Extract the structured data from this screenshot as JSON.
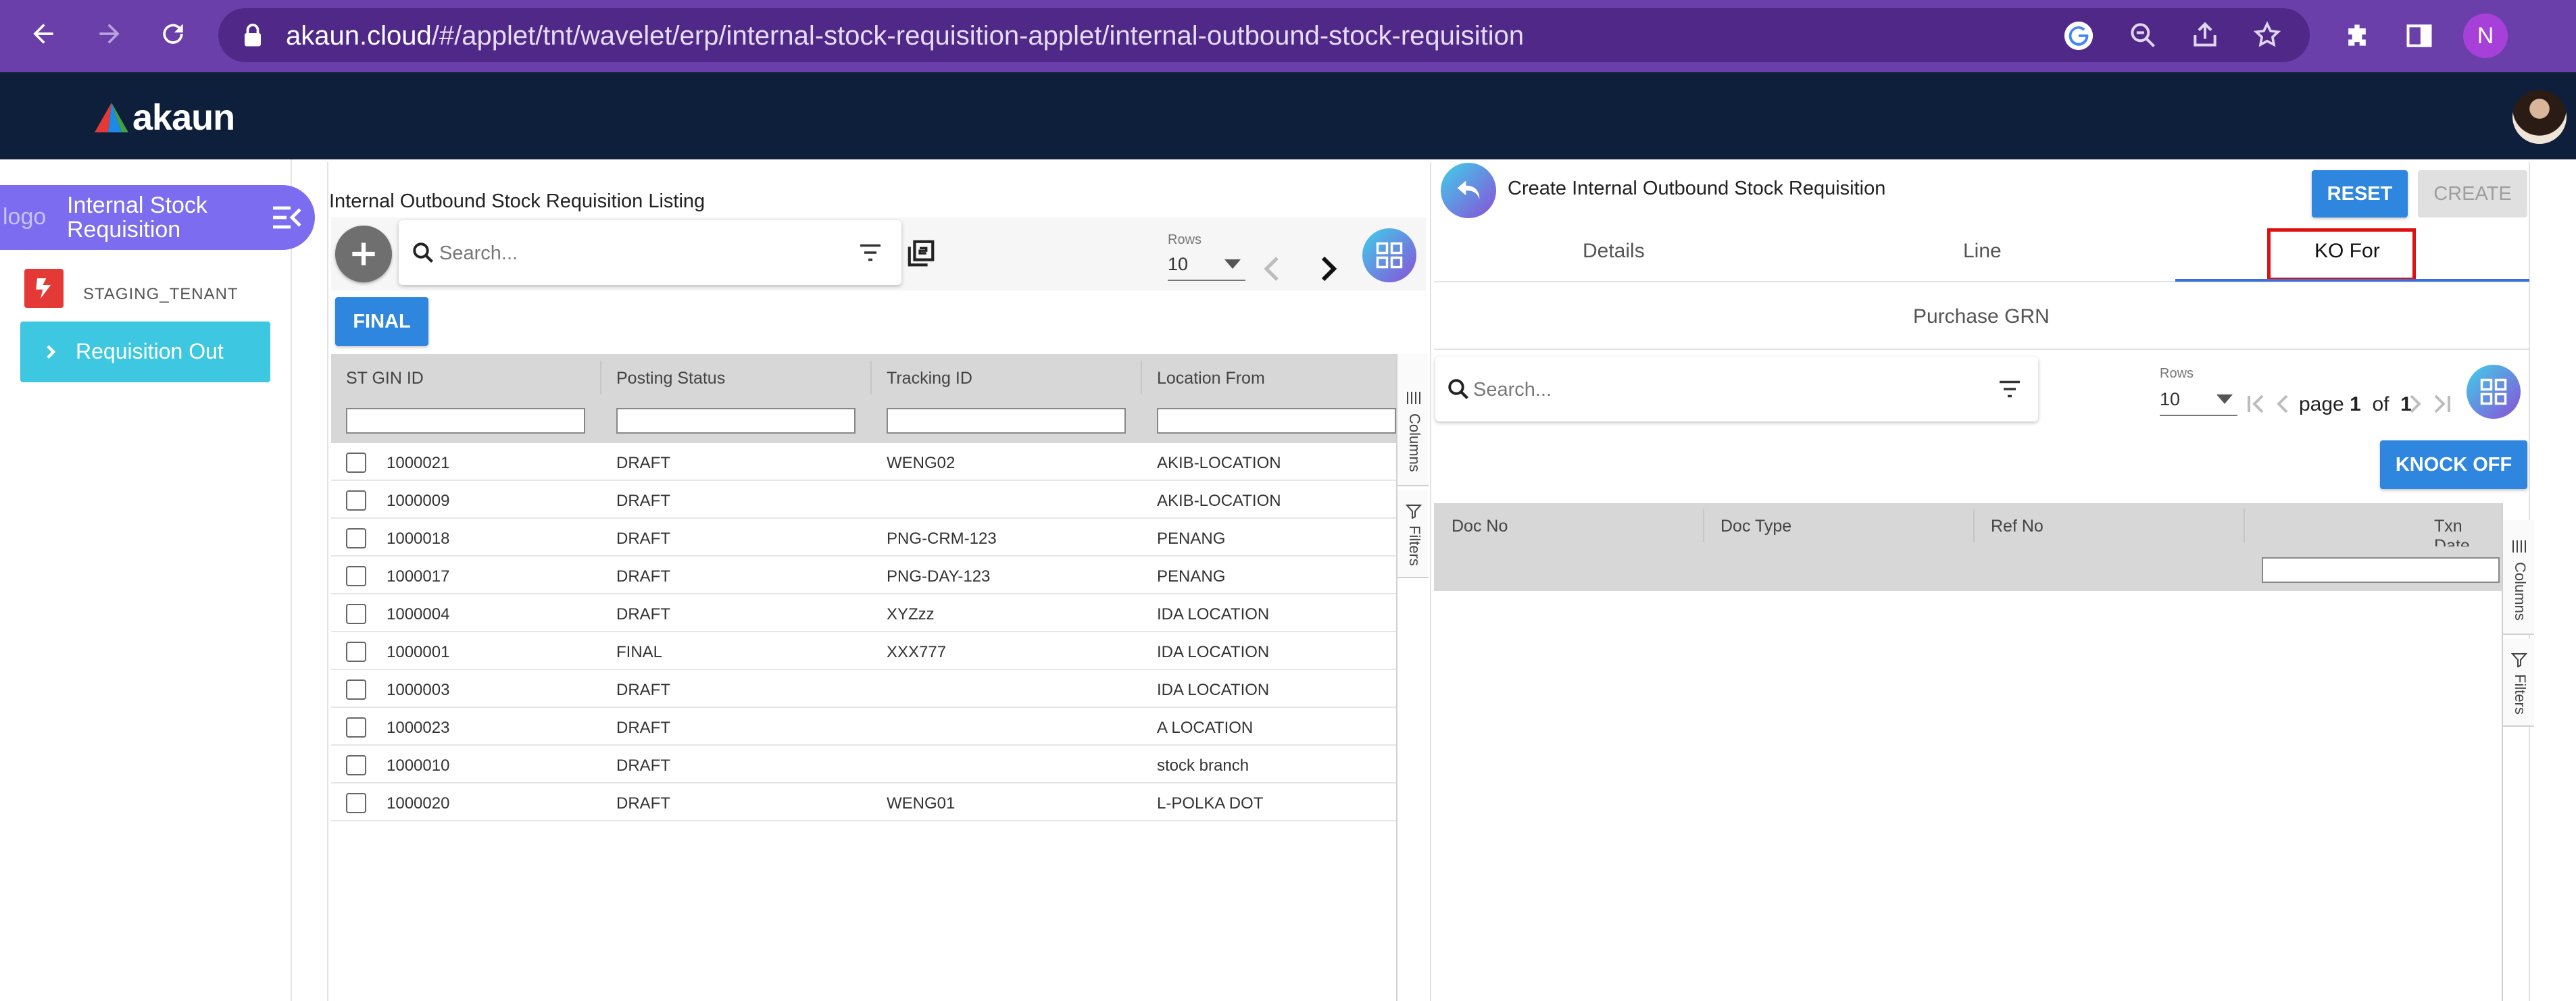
{
  "browser": {
    "url_host": "akaun.cloud",
    "url_path": "/#/applet/tnt/wavelet/erp/internal-stock-requisition-applet/internal-outbound-stock-requisition",
    "profile_initial": "N"
  },
  "app": {
    "brand": "akaun"
  },
  "sidebar": {
    "applet_logo_alt": "logo",
    "applet_name": "Internal Stock Requisition",
    "tenant": "STAGING_TENANT",
    "menu_item": "Requisition Out"
  },
  "listing": {
    "title": "Internal Outbound Stock Requisition Listing",
    "search_placeholder": "Search...",
    "rows_label": "Rows",
    "rows_value": "10",
    "final_button": "FINAL",
    "columns": [
      "ST GIN ID",
      "Posting Status",
      "Tracking ID",
      "Location From"
    ],
    "side_tabs": [
      "Columns",
      "Filters"
    ],
    "rows": [
      {
        "id": "1000021",
        "status": "DRAFT",
        "tracking": "WENG02",
        "location": "AKIB-LOCATION"
      },
      {
        "id": "1000009",
        "status": "DRAFT",
        "tracking": "",
        "location": "AKIB-LOCATION"
      },
      {
        "id": "1000018",
        "status": "DRAFT",
        "tracking": "PNG-CRM-123",
        "location": "PENANG"
      },
      {
        "id": "1000017",
        "status": "DRAFT",
        "tracking": "PNG-DAY-123",
        "location": "PENANG"
      },
      {
        "id": "1000004",
        "status": "DRAFT",
        "tracking": "XYZzz",
        "location": "IDA LOCATION"
      },
      {
        "id": "1000001",
        "status": "FINAL",
        "tracking": "XXX777",
        "location": "IDA LOCATION"
      },
      {
        "id": "1000003",
        "status": "DRAFT",
        "tracking": "",
        "location": "IDA LOCATION"
      },
      {
        "id": "1000023",
        "status": "DRAFT",
        "tracking": "",
        "location": "A LOCATION"
      },
      {
        "id": "1000010",
        "status": "DRAFT",
        "tracking": "",
        "location": "stock branch"
      },
      {
        "id": "1000020",
        "status": "DRAFT",
        "tracking": "WENG01",
        "location": "L-POLKA DOT"
      }
    ]
  },
  "create": {
    "title": "Create Internal Outbound Stock Requisition",
    "reset_button": "RESET",
    "create_button": "CREATE",
    "tabs": [
      "Details",
      "Line",
      "KO For"
    ],
    "active_tab": "KO For",
    "sub_tab": "Purchase GRN",
    "search_placeholder": "Search...",
    "rows_label": "Rows",
    "rows_value": "10",
    "pager": {
      "page_word": "page",
      "page": "1",
      "of_word": "of",
      "total": "1"
    },
    "knock_off_button": "KNOCK OFF",
    "columns": [
      "Doc No",
      "Doc Type",
      "Ref No",
      "Txn Date"
    ],
    "side_tabs": [
      "Columns",
      "Filters"
    ]
  },
  "colors": {
    "browser_chrome": "#6a3fa9",
    "app_header": "#0d1f3a",
    "applet_pill": "#7b6cf0",
    "menu_active": "#3ec7e0",
    "primary_button": "#2e86de",
    "highlight_box": "#e01010"
  },
  "icons": [
    "back-arrow-icon",
    "forward-arrow-icon",
    "reload-icon",
    "lock-icon",
    "google-icon",
    "zoom-icon",
    "share-icon",
    "star-icon",
    "extensions-icon",
    "sidepanel-icon",
    "menu-collapse-icon",
    "chevron-right-icon",
    "plus-icon",
    "search-icon",
    "filter-icon",
    "copy-icon",
    "grid-icon",
    "undo-arrow-icon",
    "first-page-icon",
    "prev-page-icon",
    "next-page-icon",
    "last-page-icon",
    "dropdown-arrow-icon"
  ]
}
